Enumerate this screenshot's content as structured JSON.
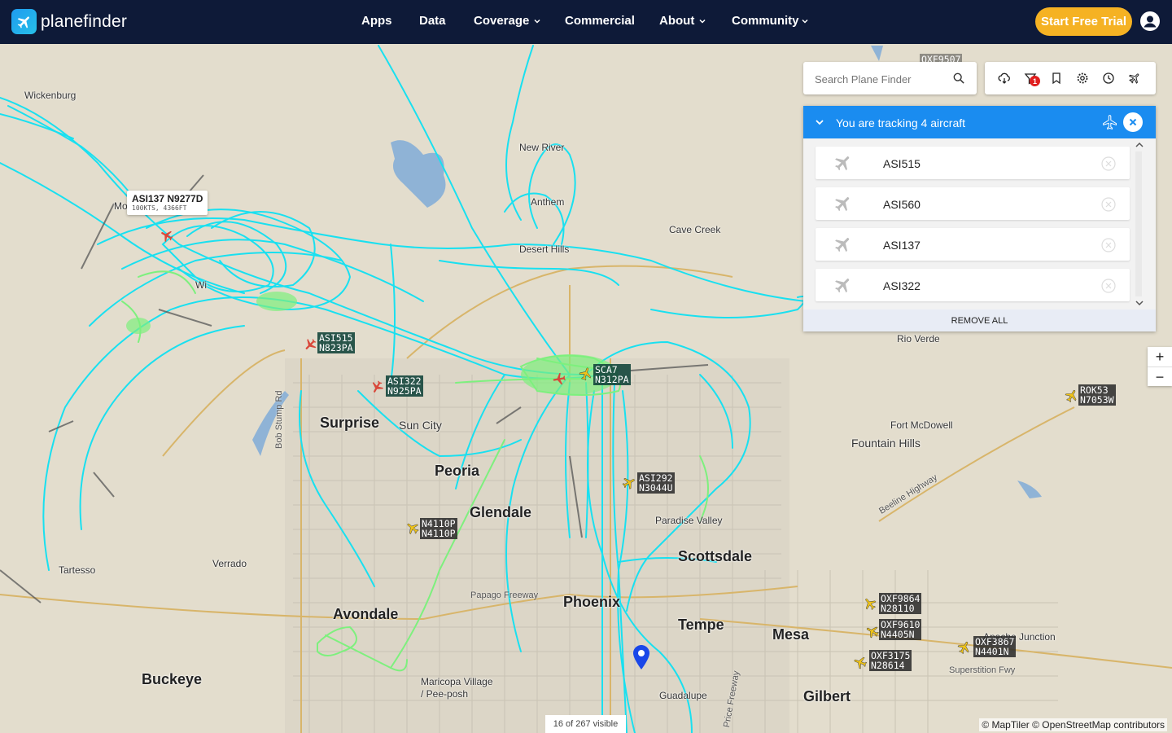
{
  "brand": {
    "name": "planefinder",
    "logo_icon": "plane-logo-icon"
  },
  "nav": {
    "items": [
      {
        "label": "Apps",
        "dropdown": false
      },
      {
        "label": "Data",
        "dropdown": false
      },
      {
        "label": "Coverage",
        "dropdown": true
      },
      {
        "label": "Commercial",
        "dropdown": false
      },
      {
        "label": "About",
        "dropdown": true
      },
      {
        "label": "Community",
        "dropdown": true
      }
    ],
    "cta": "Start Free Trial"
  },
  "search": {
    "placeholder": "Search Plane Finder"
  },
  "toolbar": {
    "icons": [
      "cloud-icon",
      "filter-icon",
      "bookmark-icon",
      "settings-gear-icon",
      "history-icon",
      "aircraft-settings-icon"
    ],
    "filter_badge": "1"
  },
  "tracking": {
    "title": "You are tracking 4 aircraft",
    "aircraft": [
      "ASI515",
      "ASI560",
      "ASI137",
      "ASI322"
    ],
    "remove_all": "REMOVE ALL"
  },
  "zoom": {
    "in": "+",
    "out": "−"
  },
  "map": {
    "visible_count": "16 of 267 visible",
    "attribution": "© MapTiler © OpenStreetMap contributors",
    "selected_tooltip": {
      "title": "ASI137 N9277D",
      "sub": "100KTS, 4366FT"
    },
    "places_small": [
      "Wickenburg",
      "New River",
      "Cave Creek",
      "Anthem",
      "Desert Hills",
      "Rio Verde",
      "Fort McDowell",
      "Fountain Hills",
      "Sun City",
      "Paradise Valley",
      "Tartesso",
      "Verrado",
      "Maricopa Village / Pee-posh",
      "Guadalupe",
      "Apache Junction",
      "Mo",
      "Wi",
      "OXF9507"
    ],
    "places_large": [
      "Surprise",
      "Peoria",
      "Glendale",
      "Scottsdale",
      "Avondale",
      "Phoenix",
      "Tempe",
      "Mesa",
      "Buckeye",
      "Gilbert"
    ],
    "roads": [
      "Bob Stump Rd",
      "Papago Freeway",
      "Beeline Highway",
      "Superstition Fwy",
      "Price Freeway"
    ],
    "aircraft_labels": [
      {
        "callsign": "ASI515",
        "reg": "N823PA",
        "color": "#d9473a"
      },
      {
        "callsign": "ASI322",
        "reg": "N925PA",
        "color": "#d9473a"
      },
      {
        "callsign": "SCA7",
        "reg": "N312PA",
        "color": "#f0c419"
      },
      {
        "callsign": "ASI292",
        "reg": "N3044U",
        "color": "#f0c419"
      },
      {
        "callsign": "N4110P",
        "reg": "N4110P",
        "color": "#f0c419"
      },
      {
        "callsign": "ROK53",
        "reg": "N7053W",
        "color": "#f0c419"
      },
      {
        "callsign": "OXF9864",
        "reg": "N28110",
        "color": "#f0c419"
      },
      {
        "callsign": "OXF9610",
        "reg": "N4405N",
        "color": "#f0c419"
      },
      {
        "callsign": "OXF3867",
        "reg": "N4401N",
        "color": "#f0c419"
      },
      {
        "callsign": "OXF3175",
        "reg": "N28614",
        "color": "#f0c419"
      }
    ],
    "track_color": "#19e0f0",
    "track_color_low": "#7ef07e"
  }
}
